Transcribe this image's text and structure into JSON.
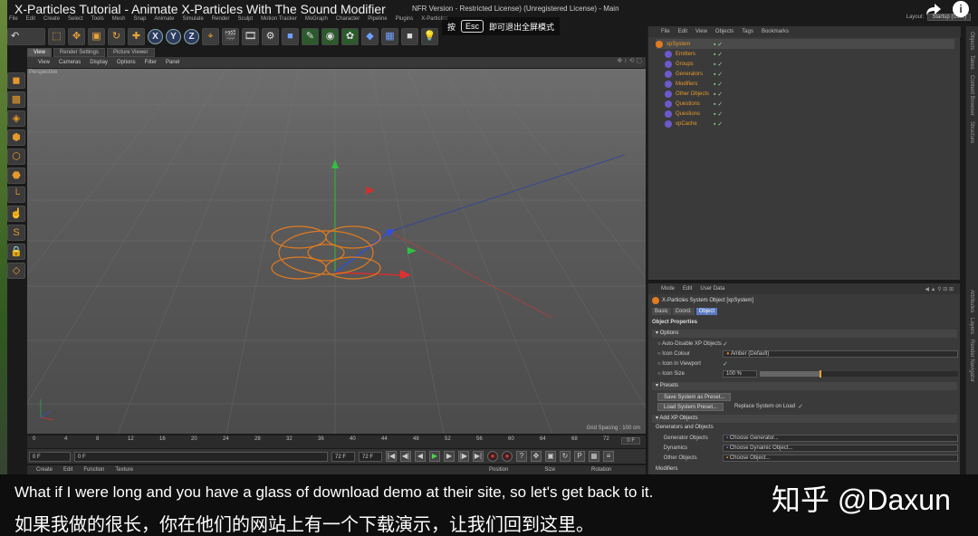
{
  "video": {
    "title": "X-Particles Tutorial - Animate X-Particles With The Sound Modifier",
    "share_icon": "share-icon",
    "info_icon": "info-icon"
  },
  "c4d_title_suffix": "NFR Version - Restricted License) (Unregistered License) - Main",
  "fullscreen_hint": {
    "prefix": "按",
    "key": "Esc",
    "suffix": "即可退出全屏模式"
  },
  "menubar": [
    "File",
    "Edit",
    "Create",
    "Select",
    "Tools",
    "Mesh",
    "Snap",
    "Animate",
    "Simulate",
    "Render",
    "Sculpt",
    "Motion Tracker",
    "MoGraph",
    "Character",
    "Pipeline",
    "Plugins",
    "X-Particles"
  ],
  "layout": {
    "label": "Layout:",
    "value": "Startup (User)"
  },
  "toolbar": {
    "axis_x": "X",
    "axis_y": "Y",
    "axis_z": "Z"
  },
  "viewport": {
    "tabs": [
      "View",
      "Render Settings",
      "Picture Viewer"
    ],
    "menu": [
      "View",
      "Cameras",
      "Display",
      "Options",
      "Filter",
      "Panel"
    ],
    "label": "Perspective",
    "grid_spacing": "Grid Spacing : 100 cm"
  },
  "timeline": {
    "ticks": [
      "0",
      "4",
      "8",
      "12",
      "16",
      "20",
      "24",
      "28",
      "32",
      "36",
      "40",
      "44",
      "48",
      "52",
      "56",
      "60",
      "64",
      "68",
      "72"
    ],
    "current_frame": "0 F"
  },
  "playbar": {
    "start": "0 F",
    "min": "0 F",
    "max": "72 F",
    "end": "72 F"
  },
  "bottom_menu": [
    "Create",
    "Edit",
    "Function",
    "Texture"
  ],
  "bottom_coords": [
    "Position",
    "Size",
    "Rotation"
  ],
  "object_manager": {
    "menu": [
      "File",
      "Edit",
      "View",
      "Objects",
      "Tags",
      "Bookmarks"
    ],
    "objects": [
      {
        "name": "xpSystem",
        "type": "system"
      },
      {
        "name": "Emitters",
        "type": "child"
      },
      {
        "name": "Groups",
        "type": "child"
      },
      {
        "name": "Generators",
        "type": "child"
      },
      {
        "name": "Modifiers",
        "type": "child"
      },
      {
        "name": "Other Objects",
        "type": "child"
      },
      {
        "name": "Questions",
        "type": "child"
      },
      {
        "name": "Questions",
        "type": "child"
      },
      {
        "name": "xpCache",
        "type": "child"
      }
    ]
  },
  "right_strip": [
    "Objects",
    "Takes",
    "Content Browser",
    "Structure"
  ],
  "right_strip_lower": [
    "Attributes",
    "Layers",
    "Render Navigator"
  ],
  "attributes": {
    "menu": [
      "Mode",
      "Edit",
      "User Data"
    ],
    "header": "X-Particles System Object [xpSystem]",
    "tabs": [
      "Basic",
      "Coord.",
      "Object"
    ],
    "active_tab": "Object",
    "properties_title": "Object Properties",
    "options_title": "Options",
    "auto_disable": "Auto-Disable XP Objects",
    "icon_colour": "Icon Colour",
    "icon_colour_value": "Amber (Default)",
    "icon_in_viewport": "Icon in Viewport",
    "icon_size": "Icon Size",
    "icon_size_value": "100 %",
    "icon_size_fraction": 0.3,
    "presets_title": "Presets",
    "save_preset": "Save System as Preset...",
    "load_preset": "Load System Preset...",
    "replace_on_load": "Replace System on Load",
    "add_xp_title": "Add XP Objects",
    "generators_and_objects": "Generators and Objects",
    "generator_objects": "Generator Objects",
    "choose_generator": "Choose Generator...",
    "dynamics": "Dynamics",
    "choose_dynamic": "Choose Dynamic Object...",
    "other_objects": "Other Objects",
    "choose_object": "Choose Object...",
    "modifiers": "Modifiers"
  },
  "subtitles": {
    "en": "What if I were long and you have a glass of download demo at their site, so let's get back to it.",
    "zh": "如果我做的很长，你在他们的网站上有一个下载演示，让我们回到这里。"
  },
  "watermark": "知乎 @Daxun"
}
